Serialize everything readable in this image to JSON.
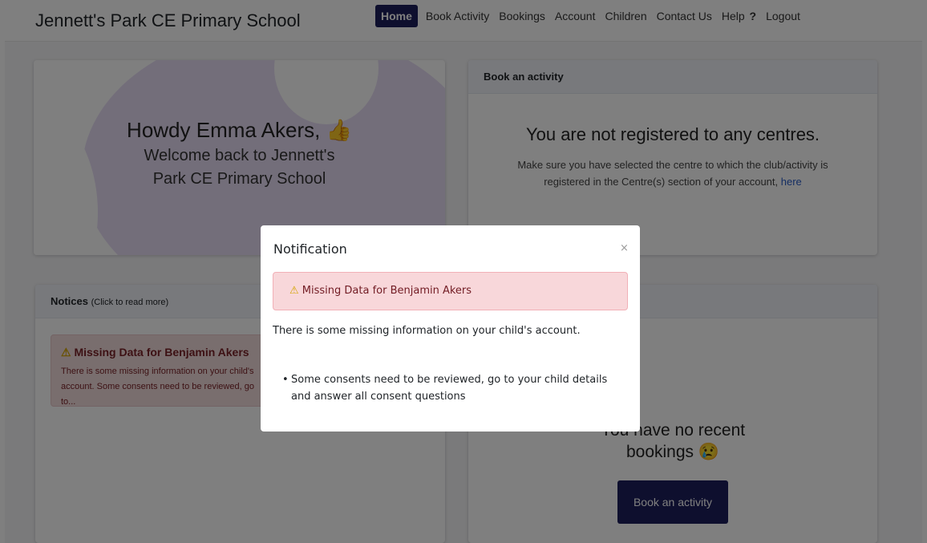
{
  "navbar": {
    "brand": "Jennett's Park CE Primary School",
    "items": [
      "Home",
      "Book Activity",
      "Bookings",
      "Account",
      "Children",
      "Contact Us",
      "Help",
      "Logout"
    ],
    "help_icon": "?",
    "accent_color": "#1d1e5c"
  },
  "welcome": {
    "greeting": "Howdy Emma Akers,",
    "thumb_icon": "👍",
    "line1": "Welcome back to Jennett's",
    "line2": "Park CE Primary School"
  },
  "book_card": {
    "header": "Book an activity",
    "headline": "You are not registered to any centres.",
    "message": "Make sure you have selected the centre to which the club/activity is registered in the Centre(s) section of your account,",
    "link": "here"
  },
  "notices": {
    "header": "Notices",
    "header_hint": "(Click to read more)",
    "alert_title": "Missing Data for Benjamin Akers",
    "alert_body": "There is some missing information on your child's account. Some consents need to be reviewed, go to..."
  },
  "recent": {
    "line1": "You have no recent",
    "line2": "bookings",
    "sad_icon": "😢",
    "button": "Book an activity"
  },
  "modal": {
    "title": "Notification",
    "close": "×",
    "alert": "Missing Data for Benjamin Akers",
    "text": "There is some missing information on your child's account.",
    "list_item": "Some consents need to be reviewed, go to your child details and answer all consent questions"
  }
}
